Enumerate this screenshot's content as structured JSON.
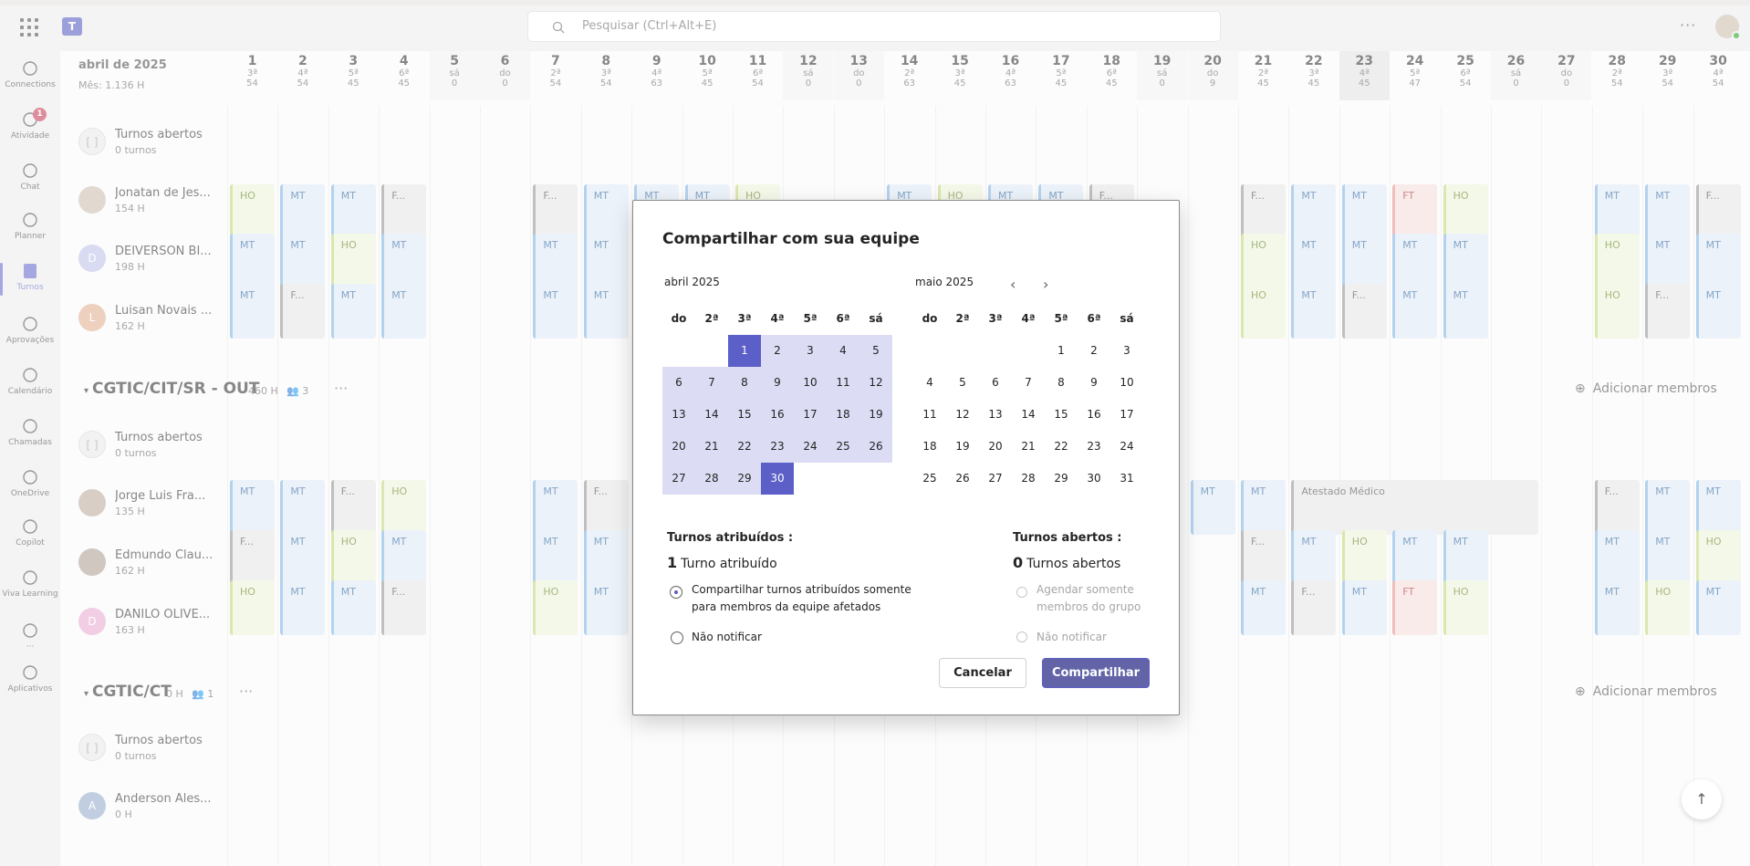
{
  "search": {
    "placeholder": "Pesquisar (Ctrl+Alt+E)"
  },
  "topbar": {
    "more": "···"
  },
  "rail": [
    {
      "label": "Connections",
      "icon": "connections-icon"
    },
    {
      "label": "Atividade",
      "icon": "bell-icon",
      "badge": "1"
    },
    {
      "label": "Chat",
      "icon": "chat-icon"
    },
    {
      "label": "Planner",
      "icon": "planner-icon"
    },
    {
      "label": "Turnos",
      "icon": "shifts-icon",
      "active": true
    },
    {
      "label": "Aprovações",
      "icon": "approvals-icon"
    },
    {
      "label": "Calendário",
      "icon": "calendar-icon"
    },
    {
      "label": "Chamadas",
      "icon": "phone-icon"
    },
    {
      "label": "OneDrive",
      "icon": "cloud-icon"
    },
    {
      "label": "Copilot",
      "icon": "copilot-icon"
    },
    {
      "label": "Viva Learning",
      "icon": "book-icon"
    },
    {
      "label": "···",
      "icon": "more-icon"
    },
    {
      "label": "Aplicativos",
      "icon": "add-app-icon"
    }
  ],
  "schedule": {
    "month": "abril de 2025",
    "month_hours": "Mês: 1.136 H",
    "days": [
      {
        "d": "1",
        "w": "3ª",
        "h": "54"
      },
      {
        "d": "2",
        "w": "4ª",
        "h": "54"
      },
      {
        "d": "3",
        "w": "5ª",
        "h": "45"
      },
      {
        "d": "4",
        "w": "6ª",
        "h": "45"
      },
      {
        "d": "5",
        "w": "sá",
        "h": "0"
      },
      {
        "d": "6",
        "w": "do",
        "h": "0"
      },
      {
        "d": "7",
        "w": "2ª",
        "h": "54"
      },
      {
        "d": "8",
        "w": "3ª",
        "h": "54"
      },
      {
        "d": "9",
        "w": "4ª",
        "h": "63"
      },
      {
        "d": "10",
        "w": "5ª",
        "h": "45"
      },
      {
        "d": "11",
        "w": "6ª",
        "h": "54"
      },
      {
        "d": "12",
        "w": "sá",
        "h": "0"
      },
      {
        "d": "13",
        "w": "do",
        "h": "0"
      },
      {
        "d": "14",
        "w": "2ª",
        "h": "63"
      },
      {
        "d": "15",
        "w": "3ª",
        "h": "45"
      },
      {
        "d": "16",
        "w": "4ª",
        "h": "63"
      },
      {
        "d": "17",
        "w": "5ª",
        "h": "45"
      },
      {
        "d": "18",
        "w": "6ª",
        "h": "45"
      },
      {
        "d": "19",
        "w": "sá",
        "h": "0"
      },
      {
        "d": "20",
        "w": "do",
        "h": "9"
      },
      {
        "d": "21",
        "w": "2ª",
        "h": "45"
      },
      {
        "d": "22",
        "w": "3ª",
        "h": "45"
      },
      {
        "d": "23",
        "w": "4ª",
        "h": "45"
      },
      {
        "d": "24",
        "w": "5ª",
        "h": "47"
      },
      {
        "d": "25",
        "w": "6ª",
        "h": "54"
      },
      {
        "d": "26",
        "w": "sá",
        "h": "0"
      },
      {
        "d": "27",
        "w": "do",
        "h": "0"
      },
      {
        "d": "28",
        "w": "2ª",
        "h": "54"
      },
      {
        "d": "29",
        "w": "3ª",
        "h": "54"
      },
      {
        "d": "30",
        "w": "4ª",
        "h": "54"
      }
    ],
    "open_shifts_label": "Turnos abertos",
    "open_shifts_count": "0 turnos",
    "group1": {
      "people": [
        {
          "name": "Jonatan de Jes...",
          "hours": "154 H"
        },
        {
          "name": "DEIVERSON BI...",
          "hours": "198 H",
          "initial": "D"
        },
        {
          "name": "Luisan Novais ...",
          "hours": "162 H",
          "initial": "L"
        }
      ]
    },
    "group2": {
      "title": "CGTIC/CIT/SR - OUT",
      "hours": "460 H",
      "members": "3",
      "add_label": "Adicionar membros",
      "people": [
        {
          "name": "Jorge Luis Fra...",
          "hours": "135 H"
        },
        {
          "name": "Edmundo Clau...",
          "hours": "162 H"
        },
        {
          "name": "DANILO OLIVE...",
          "hours": "163 H",
          "initial": "D"
        }
      ],
      "long_shift": "Atestado Médico"
    },
    "group3": {
      "title": "CGTIC/CT",
      "hours": "0 H",
      "members": "1",
      "add_label": "Adicionar membros",
      "people": [
        {
          "name": "Anderson Ales...",
          "hours": "0 H",
          "initial": "A"
        }
      ]
    },
    "more": "···"
  },
  "dialog": {
    "title": "Compartilhar com sua equipe",
    "april": {
      "title": "abril 2025",
      "headers": [
        "do",
        "2ª",
        "3ª",
        "4ª",
        "5ª",
        "6ª",
        "sá"
      ],
      "days": [
        "",
        "",
        "1",
        "2",
        "3",
        "4",
        "5",
        "6",
        "7",
        "8",
        "9",
        "10",
        "11",
        "12",
        "13",
        "14",
        "15",
        "16",
        "17",
        "18",
        "19",
        "20",
        "21",
        "22",
        "23",
        "24",
        "25",
        "26",
        "27",
        "28",
        "29",
        "30"
      ]
    },
    "may": {
      "title": "maio 2025",
      "headers": [
        "do",
        "2ª",
        "3ª",
        "4ª",
        "5ª",
        "6ª",
        "sá"
      ],
      "days": [
        "",
        "",
        "",
        "",
        "1",
        "2",
        "3",
        "4",
        "5",
        "6",
        "7",
        "8",
        "9",
        "10",
        "11",
        "12",
        "13",
        "14",
        "15",
        "16",
        "17",
        "18",
        "19",
        "20",
        "21",
        "22",
        "23",
        "24",
        "25",
        "26",
        "27",
        "28",
        "29",
        "30",
        "31"
      ]
    },
    "assigned": {
      "title": "Turnos atribuídos :",
      "count": "1",
      "count_label": "Turno atribuído",
      "option1": "Compartilhar turnos atribuídos somente para membros da equipe afetados",
      "option2": "Não notificar"
    },
    "open": {
      "title": "Turnos abertos :",
      "count": "0",
      "count_label": "Turnos abertos",
      "option1": "Agendar somente membros do grupo",
      "option2": "Não notificar"
    },
    "cancel_label": "Cancelar",
    "share_label": "Compartilhar"
  },
  "colors": {
    "accent": "#5b5fc7",
    "button": "#6264a7",
    "range": "#dcdcf4"
  }
}
